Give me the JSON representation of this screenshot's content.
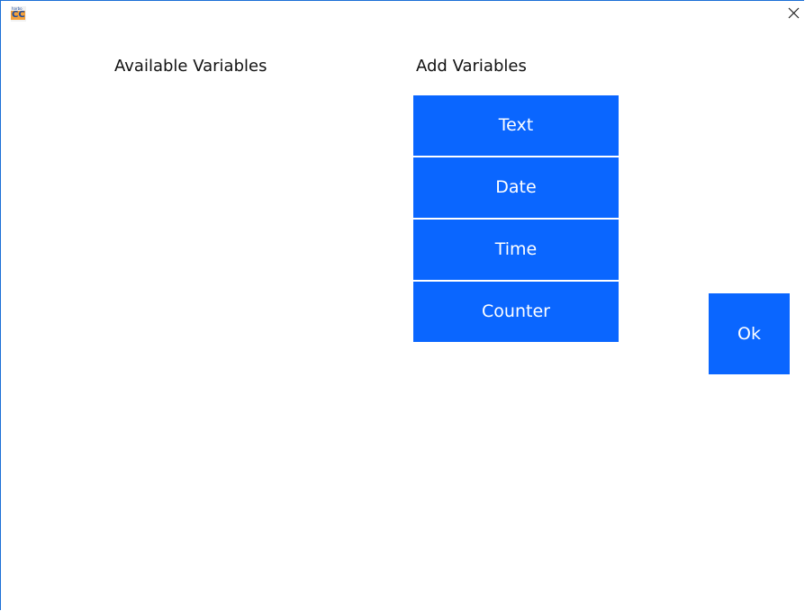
{
  "window": {
    "icon": "app-logo-icon",
    "icon_caption": "harbo",
    "icon_letters": "CC",
    "close_icon": "close-icon",
    "close_symbol": "×"
  },
  "available": {
    "heading": "Available Variables",
    "items": []
  },
  "add": {
    "heading": "Add Variables",
    "buttons": [
      {
        "label": "Text"
      },
      {
        "label": "Date"
      },
      {
        "label": "Time"
      },
      {
        "label": "Counter"
      }
    ]
  },
  "ok": {
    "label": "Ok"
  },
  "colors": {
    "button_bg": "#0a66ff",
    "button_text": "#ffffff",
    "window_border": "#1b6fd6"
  }
}
